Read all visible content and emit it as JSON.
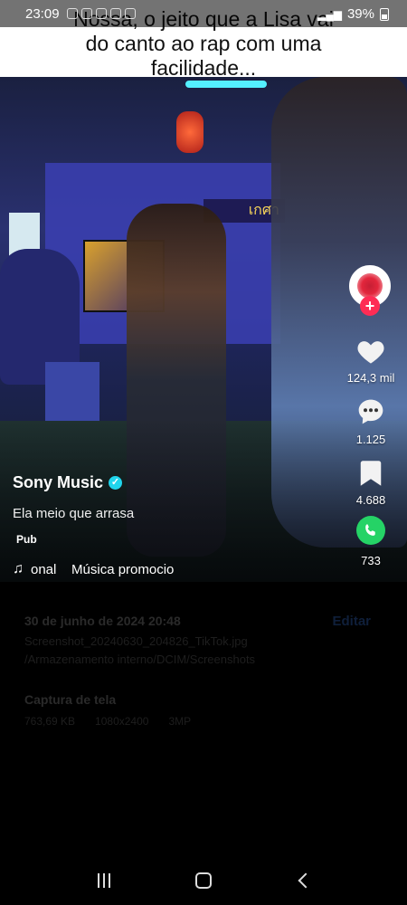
{
  "status_bar": {
    "time": "23:09",
    "battery": "39%"
  },
  "caption": {
    "line1": "Nossa, o jeito que a Lisa vai",
    "line2": "do canto ao rap com uma",
    "line3": "facilidade..."
  },
  "video": {
    "username": "Sony Music",
    "description": "Ela meio que arrasa",
    "badge": "Pub",
    "music_text": "onal    Música promocio",
    "likes": "124,3 mil",
    "comments": "1.125",
    "saves": "4.688",
    "shares": "733",
    "sign_text": "เกศา",
    "icons": {
      "like": "heart-icon",
      "comment": "comment-icon",
      "save": "bookmark-icon",
      "share": "whatsapp-icon",
      "music": "music-note-icon",
      "verified": "verified-icon"
    }
  },
  "details": {
    "date": "30 de junho de 2024 20:48",
    "edit_label": "Editar",
    "filename": "Screenshot_20240630_204826_TikTok.jpg",
    "path": "/Armazenamento interno/DCIM/Screenshots",
    "type_title": "Captura de tela",
    "size": "763,69 KB",
    "resolution": "1080x2400",
    "megapixels": "3MP"
  },
  "colors": {
    "tiktok_red": "#fe2c55",
    "verified": "#20d5ec",
    "whatsapp": "#25d366"
  }
}
